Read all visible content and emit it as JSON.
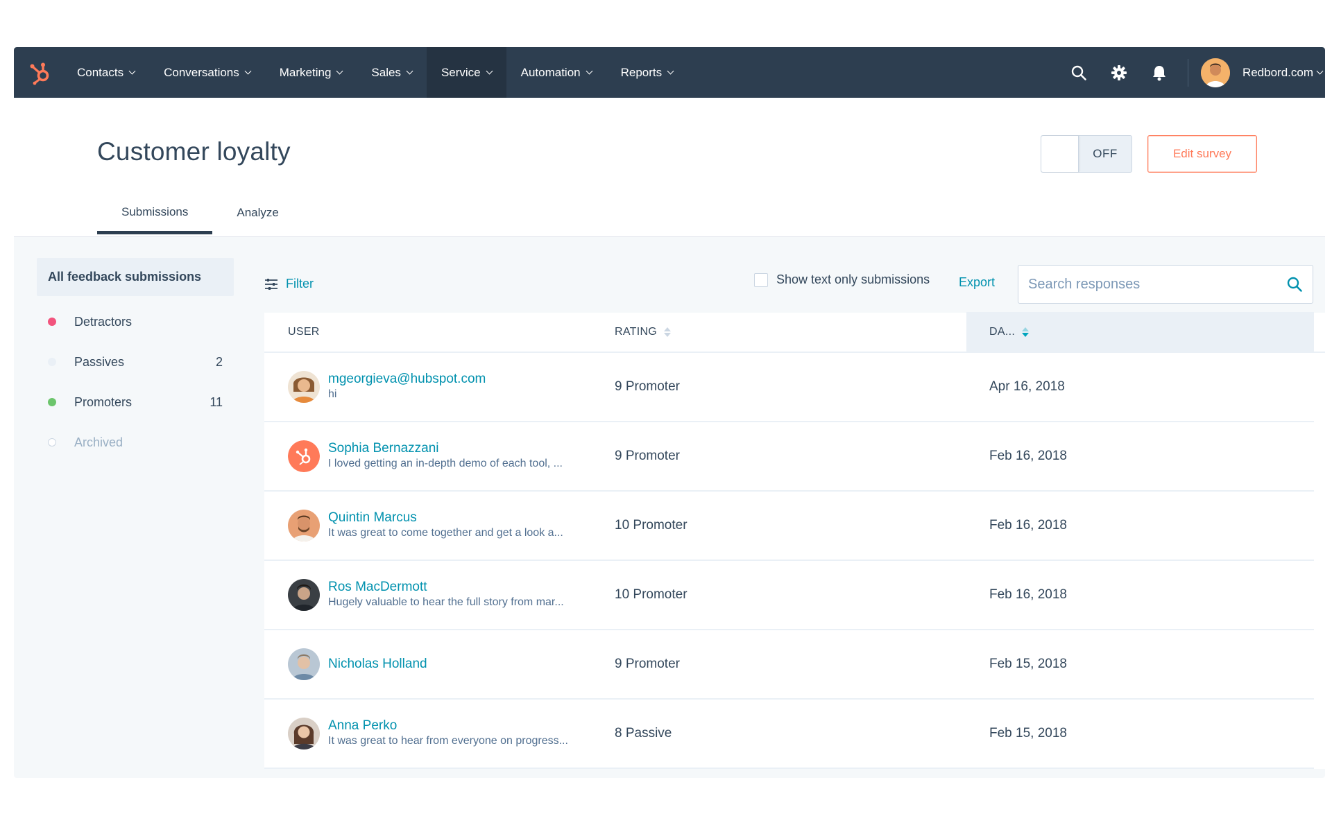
{
  "nav": {
    "items": [
      {
        "label": "Contacts",
        "active": false
      },
      {
        "label": "Conversations",
        "active": false
      },
      {
        "label": "Marketing",
        "active": false
      },
      {
        "label": "Sales",
        "active": false
      },
      {
        "label": "Service",
        "active": true
      },
      {
        "label": "Automation",
        "active": false
      },
      {
        "label": "Reports",
        "active": false
      }
    ],
    "account": "Redbord.com"
  },
  "header": {
    "title": "Customer loyalty",
    "toggle_label": "OFF",
    "edit_button": "Edit survey"
  },
  "tabs": [
    {
      "label": "Submissions",
      "active": true
    },
    {
      "label": "Analyze",
      "active": false
    }
  ],
  "sidebar": {
    "active_label": "All feedback submissions",
    "items": [
      {
        "label": "Detractors",
        "count": "",
        "color": "#f2547d"
      },
      {
        "label": "Passives",
        "count": "2",
        "color": "#eaf0f6"
      },
      {
        "label": "Promoters",
        "count": "11",
        "color": "#6cc56c"
      },
      {
        "label": "Archived",
        "count": "",
        "color": "#cbd6e2"
      }
    ]
  },
  "toolbar": {
    "filter_label": "Filter",
    "text_only_label": "Show text only submissions",
    "export_label": "Export",
    "search_placeholder": "Search responses"
  },
  "table": {
    "columns": {
      "user": "USER",
      "rating": "RATING",
      "date": "DA..."
    },
    "rows": [
      {
        "name": "mgeorgieva@hubspot.com",
        "comment": "hi",
        "rating": "9 Promoter",
        "date": "Apr 16, 2018",
        "avatar_color": "#d9a06b"
      },
      {
        "name": "Sophia Bernazzani",
        "comment": "I loved getting an in-depth demo of each tool, ...",
        "rating": "9 Promoter",
        "date": "Feb 16, 2018",
        "avatar_color": "#ff7a59"
      },
      {
        "name": "Quintin Marcus",
        "comment": "It was great to come together and get a look a...",
        "rating": "10 Promoter",
        "date": "Feb 16, 2018",
        "avatar_color": "#c98a5e"
      },
      {
        "name": "Ros MacDermott",
        "comment": "Hugely valuable to hear the full story from mar...",
        "rating": "10 Promoter",
        "date": "Feb 16, 2018",
        "avatar_color": "#4a4a4a"
      },
      {
        "name": "Nicholas Holland",
        "comment": "",
        "rating": "9 Promoter",
        "date": "Feb 15, 2018",
        "avatar_color": "#9fb3c6"
      },
      {
        "name": "Anna Perko",
        "comment": "It was great to hear from everyone on progress...",
        "rating": "8 Passive",
        "date": "Feb 15, 2018",
        "avatar_color": "#7a5a48"
      }
    ]
  }
}
